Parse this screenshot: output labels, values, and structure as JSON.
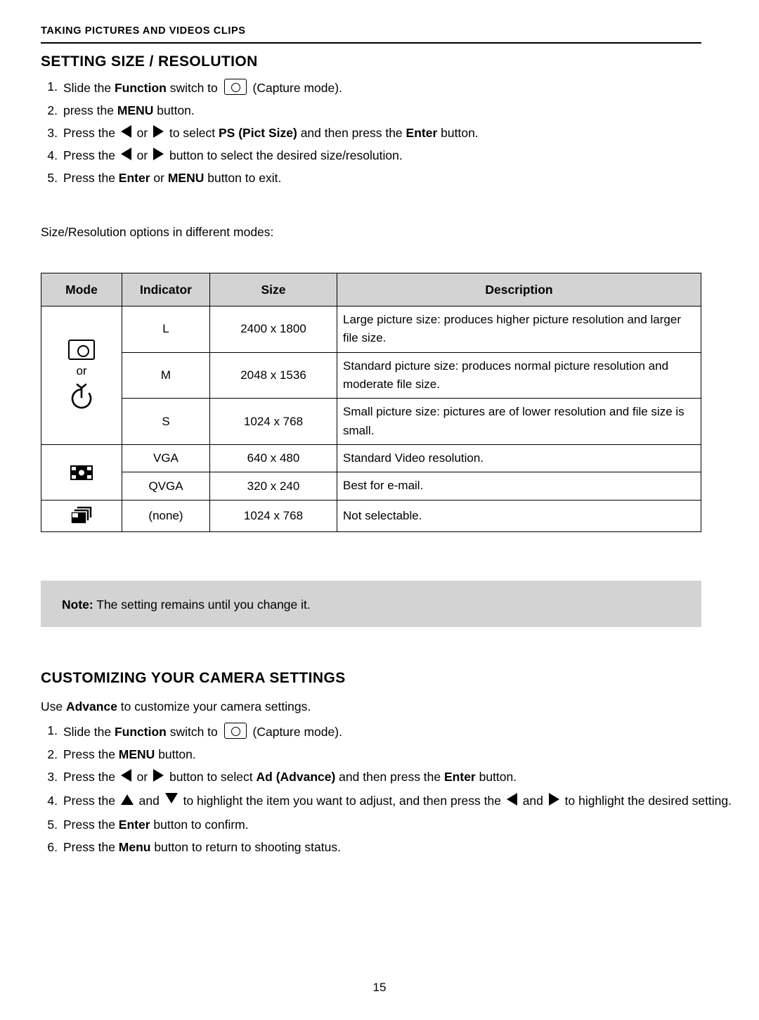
{
  "header": {
    "running_head": "TAKING PICTURES AND VIDEOS CLIPS"
  },
  "section1": {
    "title": "SETTING SIZE / RESOLUTION",
    "steps": [
      {
        "num": "1.",
        "parts": [
          {
            "t": "text",
            "v": "Slide the "
          },
          {
            "t": "bold",
            "v": "Function "
          },
          {
            "t": "text",
            "v": "switch to "
          },
          {
            "t": "icon",
            "v": "capture-mode-icon"
          },
          {
            "t": "text",
            "v": " (Capture mode)."
          }
        ]
      },
      {
        "num": "2.",
        "parts": [
          {
            "t": "text",
            "v": "press the "
          },
          {
            "t": "bold",
            "v": "MENU "
          },
          {
            "t": "text",
            "v": "button."
          }
        ]
      },
      {
        "num": "3.",
        "parts": [
          {
            "t": "text",
            "v": "Press the "
          },
          {
            "t": "icon",
            "v": "left-arrow-icon"
          },
          {
            "t": "text",
            "v": " or "
          },
          {
            "t": "icon",
            "v": "right-arrow-icon"
          },
          {
            "t": "text",
            "v": " to select "
          },
          {
            "t": "bold",
            "v": "PS (Pict Size) "
          },
          {
            "t": "text",
            "v": "and then press the "
          },
          {
            "t": "bold",
            "v": "Enter "
          },
          {
            "t": "text",
            "v": "button."
          }
        ]
      },
      {
        "num": "4.",
        "parts": [
          {
            "t": "text",
            "v": "Press the "
          },
          {
            "t": "icon",
            "v": "left-arrow-icon"
          },
          {
            "t": "text",
            "v": " or "
          },
          {
            "t": "icon",
            "v": "right-arrow-icon"
          },
          {
            "t": "text",
            "v": " button to select the desired size/resolution."
          }
        ]
      },
      {
        "num": "5.",
        "parts": [
          {
            "t": "text",
            "v": "Press the "
          },
          {
            "t": "bold",
            "v": "Enter "
          },
          {
            "t": "text",
            "v": "or "
          },
          {
            "t": "bold",
            "v": "MENU "
          },
          {
            "t": "text",
            "v": "button to exit."
          }
        ]
      }
    ],
    "intro_line": "Size/Resolution options in different modes:"
  },
  "table": {
    "headers": [
      "Mode",
      "Indicator",
      "Size",
      "Description"
    ],
    "mode_groups": [
      {
        "icons": [
          "capture-mode-icon",
          "self-timer-icon"
        ],
        "or_label": "or"
      },
      {
        "icons": [
          "video-clip-icon"
        ]
      },
      {
        "icons": [
          "burst-mode-icon"
        ]
      }
    ],
    "rows": [
      {
        "indicator": "L",
        "size": "2400 x 1800",
        "description": "Large picture size: produces higher picture resolution and larger file size."
      },
      {
        "indicator": "M",
        "size": "2048 x 1536",
        "description": "Standard picture size: produces normal picture resolution and moderate file size."
      },
      {
        "indicator": "S",
        "size": "1024 x 768",
        "description": "Small picture size: pictures are of lower resolution and file size is small."
      },
      {
        "indicator": "VGA",
        "size": "640 x 480",
        "description": "Standard Video resolution."
      },
      {
        "indicator": "QVGA",
        "size": "320 x 240",
        "description": "Best for e-mail."
      },
      {
        "indicator": "(none)",
        "size": "1024 x 768",
        "description": "Not selectable."
      }
    ]
  },
  "note": {
    "label": "Note:",
    "text": " The setting remains until you change it."
  },
  "section2": {
    "title": "CUSTOMIZING YOUR CAMERA SETTINGS",
    "lead_parts": [
      {
        "t": "text",
        "v": "Use "
      },
      {
        "t": "bold",
        "v": "Advance "
      },
      {
        "t": "text",
        "v": "to customize your camera settings."
      }
    ],
    "steps": [
      {
        "num": "1.",
        "parts": [
          {
            "t": "text",
            "v": "Slide the "
          },
          {
            "t": "bold",
            "v": "Function "
          },
          {
            "t": "text",
            "v": "switch to "
          },
          {
            "t": "icon",
            "v": "capture-mode-icon"
          },
          {
            "t": "text",
            "v": " (Capture mode)."
          }
        ]
      },
      {
        "num": "2.",
        "parts": [
          {
            "t": "text",
            "v": "Press the "
          },
          {
            "t": "bold",
            "v": "MENU "
          },
          {
            "t": "text",
            "v": "button."
          }
        ]
      },
      {
        "num": "3.",
        "parts": [
          {
            "t": "text",
            "v": "Press the "
          },
          {
            "t": "icon",
            "v": "left-arrow-icon"
          },
          {
            "t": "text",
            "v": " or "
          },
          {
            "t": "icon",
            "v": "right-arrow-icon"
          },
          {
            "t": "text",
            "v": " button to select "
          },
          {
            "t": "bold",
            "v": "Ad (Advance) "
          },
          {
            "t": "text",
            "v": "and then press the "
          },
          {
            "t": "bold",
            "v": "Enter "
          },
          {
            "t": "text",
            "v": "button."
          }
        ]
      },
      {
        "num": "4.",
        "parts": [
          {
            "t": "text",
            "v": "Press the "
          },
          {
            "t": "icon",
            "v": "up-arrow-icon"
          },
          {
            "t": "text",
            "v": " and "
          },
          {
            "t": "icon",
            "v": "down-arrow-icon"
          },
          {
            "t": "text",
            "v": " to highlight the item you want to adjust, and then press the "
          },
          {
            "t": "icon",
            "v": "left-arrow-icon"
          },
          {
            "t": "text",
            "v": " and "
          },
          {
            "t": "icon",
            "v": "right-arrow-icon"
          },
          {
            "t": "text",
            "v": " to highlight the desired setting."
          }
        ]
      },
      {
        "num": "5.",
        "parts": [
          {
            "t": "text",
            "v": "Press the "
          },
          {
            "t": "bold",
            "v": "Enter "
          },
          {
            "t": "text",
            "v": "button to confirm."
          }
        ]
      },
      {
        "num": "6.",
        "parts": [
          {
            "t": "text",
            "v": "Press the "
          },
          {
            "t": "bold",
            "v": "Menu "
          },
          {
            "t": "text",
            "v": "button to return to shooting status."
          }
        ]
      }
    ]
  },
  "footer": {
    "page_number": "15"
  }
}
